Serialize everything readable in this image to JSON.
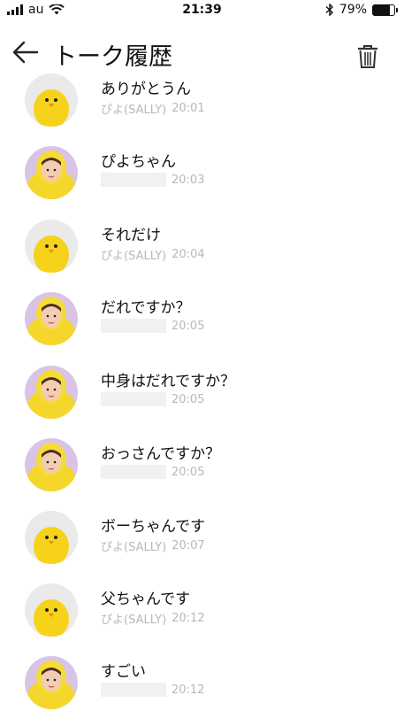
{
  "status_bar": {
    "carrier": "au",
    "time": "21:39",
    "battery_percent": "79%",
    "battery_level": 0.79
  },
  "header": {
    "title": "トーク履歴"
  },
  "messages": [
    {
      "text": "ありがとうん",
      "sender": "ぴよ(SALLY)",
      "time": "20:01",
      "avatar": "chick"
    },
    {
      "text": "ぴよちゃん",
      "sender": "",
      "time": "20:03",
      "avatar": "person"
    },
    {
      "text": "それだけ",
      "sender": "ぴよ(SALLY)",
      "time": "20:04",
      "avatar": "chick"
    },
    {
      "text": "だれですか？",
      "sender": "",
      "time": "20:05",
      "avatar": "person"
    },
    {
      "text": "中身はだれですか？",
      "sender": "",
      "time": "20:05",
      "avatar": "person"
    },
    {
      "text": "おっさんですか？",
      "sender": "",
      "time": "20:05",
      "avatar": "person"
    },
    {
      "text": "ボーちゃんです",
      "sender": "ぴよ(SALLY)",
      "time": "20:07",
      "avatar": "chick"
    },
    {
      "text": "父ちゃんです",
      "sender": "ぴよ(SALLY)",
      "time": "20:12",
      "avatar": "chick"
    },
    {
      "text": "すごい",
      "sender": "",
      "time": "20:12",
      "avatar": "person"
    }
  ]
}
